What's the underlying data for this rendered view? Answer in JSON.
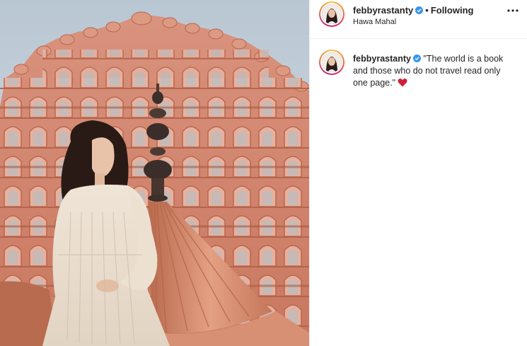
{
  "post": {
    "username": "febbyrastanty",
    "follow_status": "Following",
    "location": "Hawa Mahal",
    "caption_text": "\"The world is a book and those who do not travel read only one page.\"",
    "verified_icon": "verified-badge-icon",
    "more_icon": "more-options-icon",
    "heart_icon": "red-heart-emoji",
    "accent_color": "#3897f0",
    "heart_color": "#d0213b"
  }
}
